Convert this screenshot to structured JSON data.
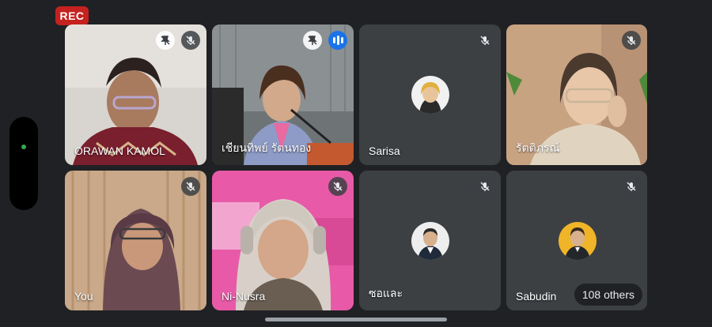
{
  "recording": {
    "label": "REC"
  },
  "participants": [
    {
      "name": "ORAWAN KAMOL",
      "muted": true,
      "pinned_icon": true
    },
    {
      "name": "เชียนทิพย์ รัตนทอง",
      "speaking": true,
      "pinned_icon": true
    },
    {
      "name": "Sarisa",
      "muted": true,
      "avatar": true
    },
    {
      "name": "รัตติภรณ์",
      "muted": true
    },
    {
      "name": "You",
      "muted": true
    },
    {
      "name": "Ni-Nusra",
      "muted": true
    },
    {
      "name": "ซอและ",
      "muted": true,
      "avatar": true
    },
    {
      "name": "Sabudin",
      "muted": true,
      "avatar": true
    }
  ],
  "others": {
    "label": "108 others"
  },
  "colors": {
    "rec": "#c5221f",
    "speaking": "#1a73e8",
    "tile": "#3c4043",
    "background": "#202124"
  }
}
